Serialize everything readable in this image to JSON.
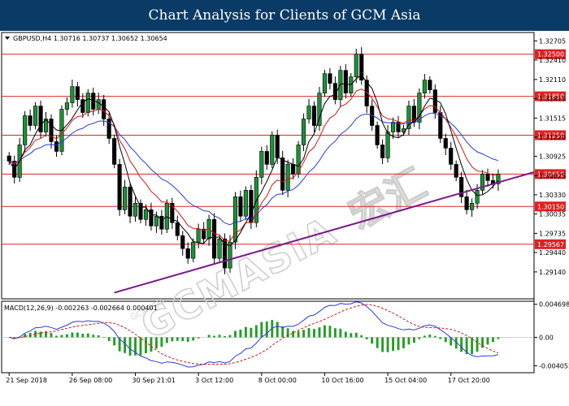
{
  "banner": {
    "title": "Chart Analysis for Clients of GCM Asia"
  },
  "watermark": {
    "text": "GCMASIA",
    "cjk": "宏汇",
    "sub": "GCMASIA"
  },
  "chart_data": {
    "type": "candlestick",
    "header": "GBPUSD,H4  1.30716 1.30737 1.30652 1.30654",
    "price_axis": {
      "range": [
        1.2875,
        1.3281
      ],
      "ticks": [
        1.32705,
        1.3241,
        1.3211,
        1.31815,
        1.31515,
        1.3122,
        1.30925,
        1.30625,
        1.3033,
        1.30035,
        1.29735,
        1.2944,
        1.2914
      ]
    },
    "levels": [
      {
        "value": 1.325,
        "label": "1.32500"
      },
      {
        "value": 1.3185,
        "label": "1.31850"
      },
      {
        "value": 1.3125,
        "label": "1.31250"
      },
      {
        "value": 1.3065,
        "label": "1.30650"
      },
      {
        "value": 1.3015,
        "label": "1.30150"
      },
      {
        "value": 1.29567,
        "label": "1.29567"
      }
    ],
    "trendline": {
      "from_bar": 20,
      "from_price": 1.2882,
      "to_bar": 115,
      "to_price": 1.3068
    },
    "time_labels": [
      "21 Sep 2018",
      "26 Sep 08:00",
      "30 Sep 21:01",
      "3 Oct 12:00",
      "8 Oct 00:00",
      "10 Oct 16:00",
      "15 Oct 04:00",
      "17 Oct 20:00"
    ],
    "time_label_bars": [
      0,
      12,
      24,
      36,
      48,
      60,
      72,
      84
    ],
    "closes": [
      1.3085,
      1.306,
      1.311,
      1.3155,
      1.314,
      1.317,
      1.313,
      1.315,
      1.3115,
      1.31,
      1.3165,
      1.3175,
      1.32,
      1.318,
      1.316,
      1.319,
      1.3165,
      1.318,
      1.315,
      1.312,
      1.308,
      1.301,
      1.3045,
      1.3,
      1.302,
      1.2995,
      1.301,
      1.2985,
      1.3,
      1.298,
      1.302,
      1.299,
      1.297,
      1.295,
      1.2935,
      1.296,
      1.298,
      1.2965,
      1.2995,
      1.2935,
      1.2965,
      1.292,
      1.296,
      1.303,
      1.3,
      1.304,
      1.299,
      1.306,
      1.31,
      1.308,
      1.3125,
      1.309,
      1.304,
      1.308,
      1.3065,
      1.311,
      1.315,
      1.317,
      1.314,
      1.319,
      1.322,
      1.3205,
      1.318,
      1.3225,
      1.319,
      1.3215,
      1.325,
      1.321,
      1.317,
      1.314,
      1.311,
      1.309,
      1.313,
      1.3145,
      1.313,
      1.3135,
      1.317,
      1.3145,
      1.319,
      1.321,
      1.3195,
      1.316,
      1.312,
      1.3105,
      1.308,
      1.306,
      1.303,
      1.301,
      1.302,
      1.304,
      1.3065,
      1.3055,
      1.305,
      1.3065
    ],
    "ma_fast_name": "",
    "ma_slow_name": "",
    "macd": {
      "header": "MACD(12,26,9) -0.002263 -0.002664 0.000401",
      "range": [
        -0.0048,
        0.0049
      ],
      "ticks": [
        0.004698,
        0.0,
        -0.004055
      ],
      "tick_labels": [
        "0.004698",
        "0.00",
        "-0.004055"
      ]
    }
  }
}
